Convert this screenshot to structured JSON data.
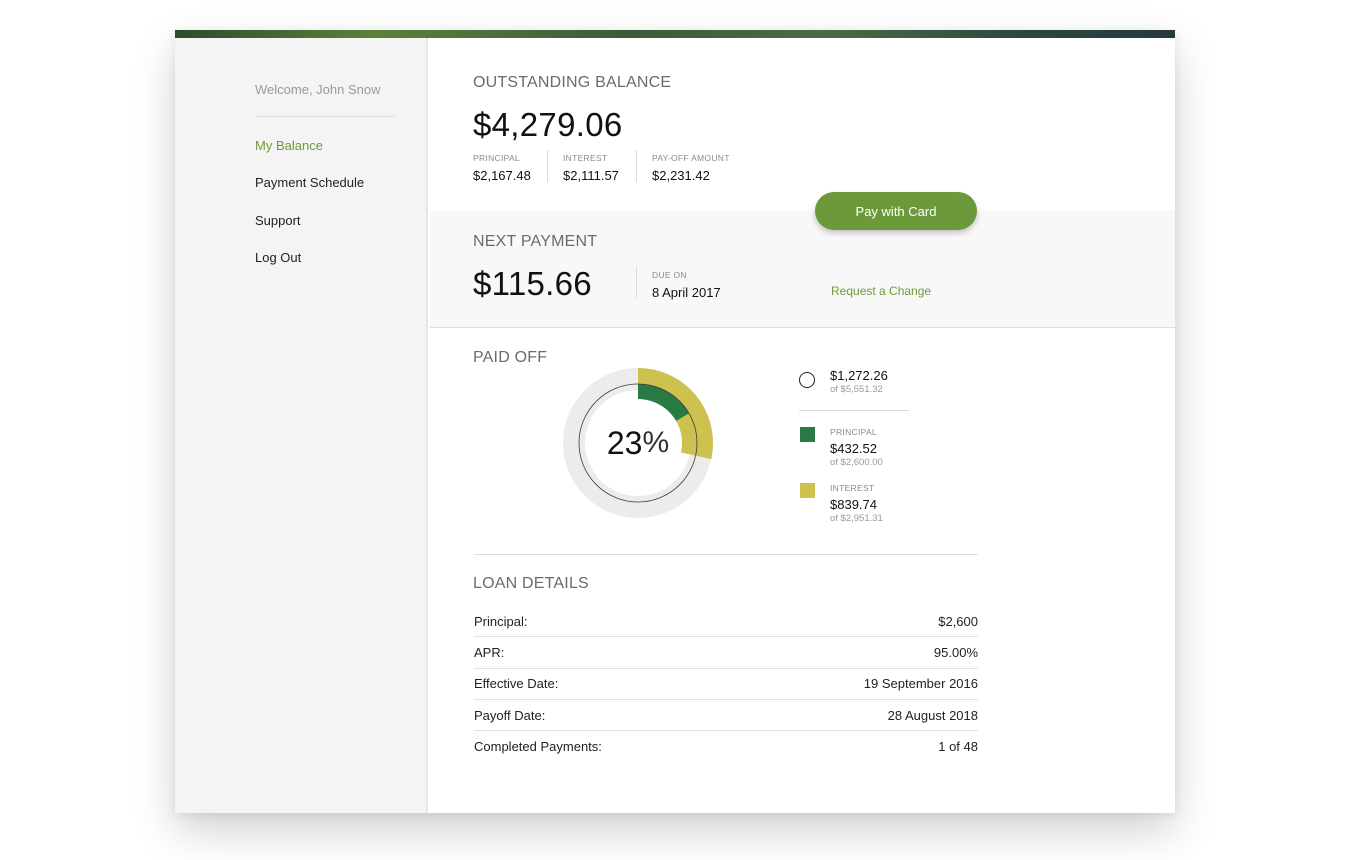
{
  "sidebar": {
    "welcome": "Welcome, John Snow",
    "items": [
      {
        "label": "My Balance",
        "active": true
      },
      {
        "label": "Payment Schedule",
        "active": false
      },
      {
        "label": "Support",
        "active": false
      },
      {
        "label": "Log Out",
        "active": false
      }
    ]
  },
  "balance": {
    "title": "OUTSTANDING BALANCE",
    "amount": "$4,279.06",
    "principal_label": "PRINCIPAL",
    "principal_value": "$2,167.48",
    "interest_label": "INTEREST",
    "interest_value": "$2,111.57",
    "payoff_label": "PAY-OFF AMOUNT",
    "payoff_value": "$2,231.42",
    "pay_button": "Pay with Card"
  },
  "next_payment": {
    "title": "NEXT PAYMENT",
    "amount": "$115.66",
    "due_label": "DUE ON",
    "due_value": "8 April 2017",
    "change_link": "Request a Change"
  },
  "paid_off": {
    "title": "PAID OFF",
    "percent_number": "23",
    "percent_sign": "%",
    "total_value": "$1,272.26",
    "total_of": "of $5,551.32",
    "principal_label": "PRINCIPAL",
    "principal_value": "$432.52",
    "principal_of": "of $2,600.00",
    "principal_fraction": 0.1664,
    "interest_label": "INTEREST",
    "interest_value": "$839.74",
    "interest_of": "of $2,951.31",
    "interest_fraction": 0.2845,
    "colors": {
      "principal": "#2a7a45",
      "interest": "#cdc24f",
      "track": "#ececea"
    }
  },
  "loan_details": {
    "title": "LOAN DETAILS",
    "rows": [
      {
        "label": "Principal:",
        "value": "$2,600"
      },
      {
        "label": "APR:",
        "value": "95.00%"
      },
      {
        "label": "Effective Date:",
        "value": "19 September 2016"
      },
      {
        "label": "Payoff Date:",
        "value": "28 August 2018"
      },
      {
        "label": "Completed Payments:",
        "value": "1 of 48"
      }
    ]
  },
  "colors": {
    "accent": "#6c9a3b",
    "sidebar_bg": "#f4f4f4"
  }
}
